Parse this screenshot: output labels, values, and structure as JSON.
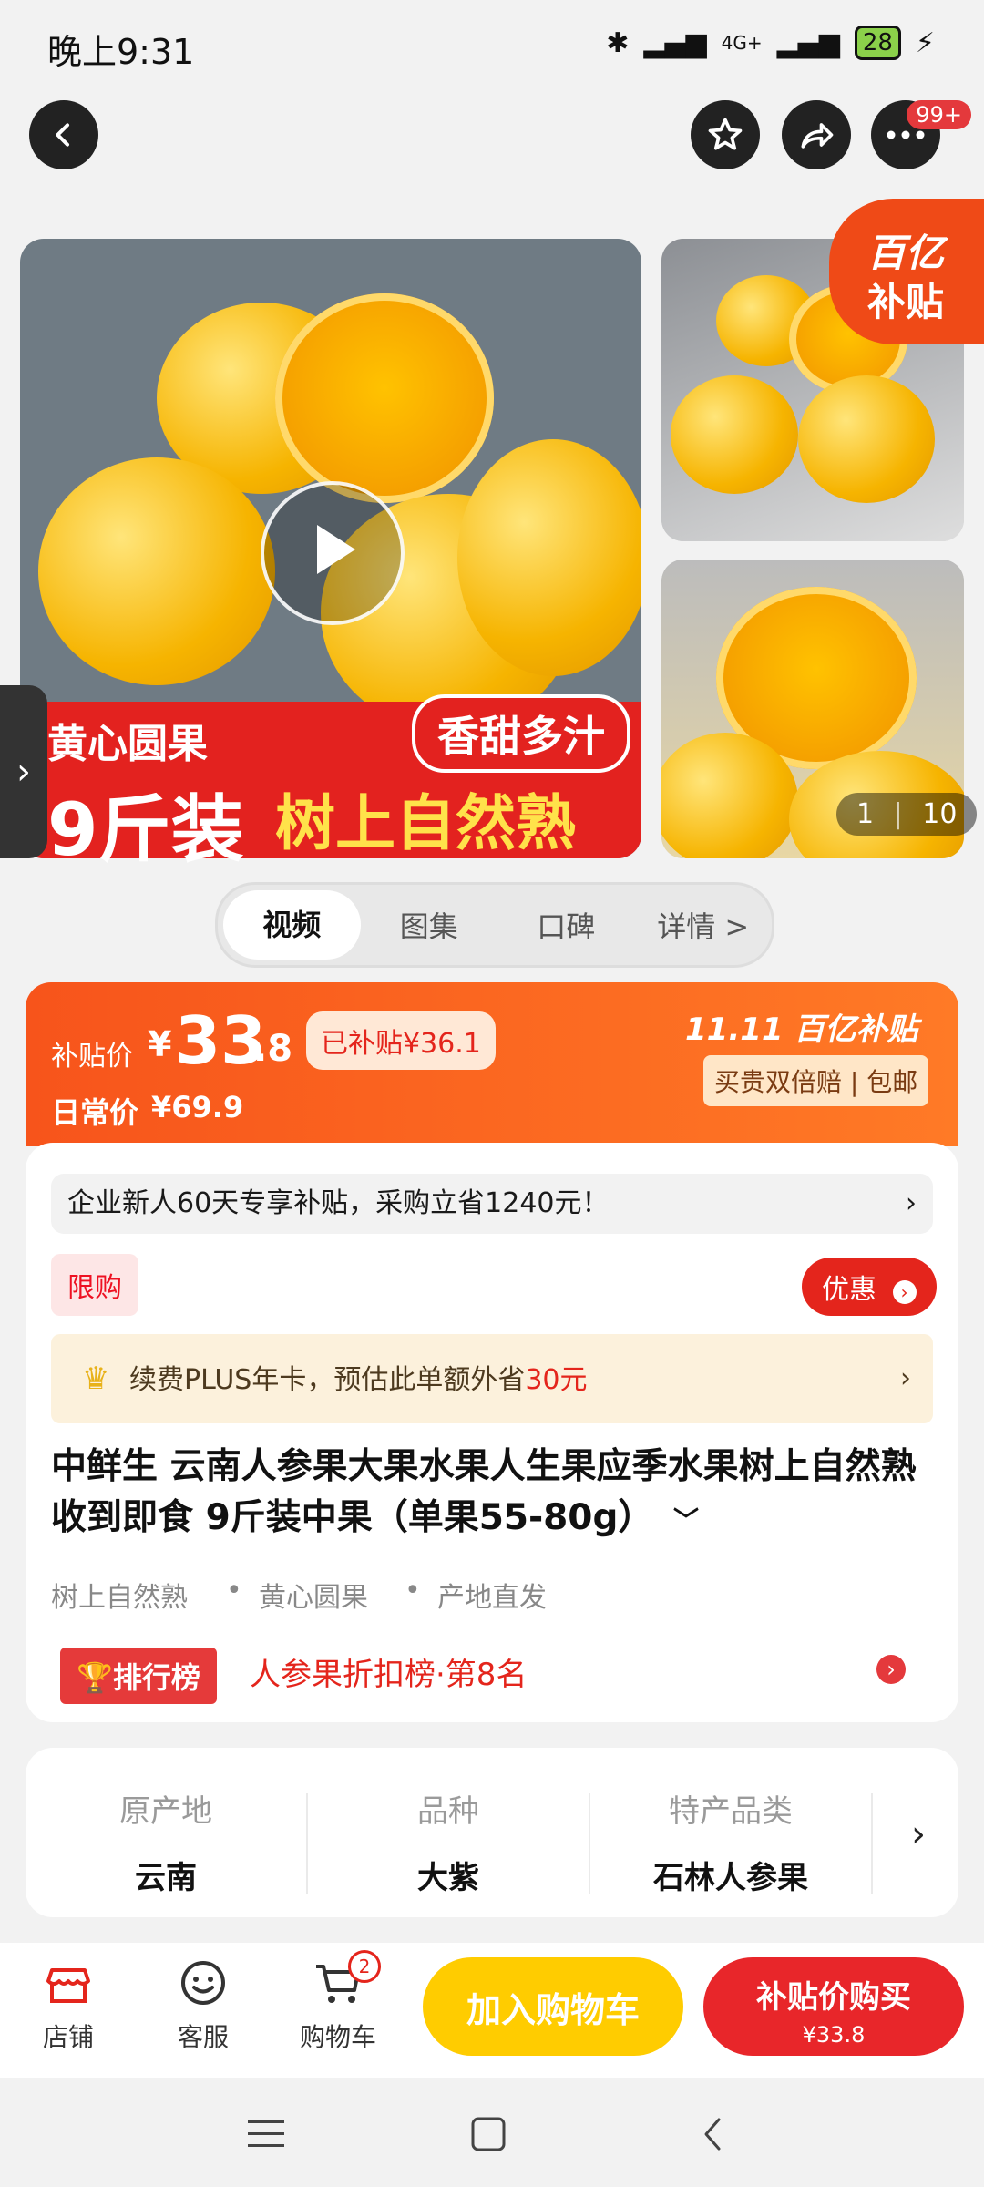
{
  "status_bar": {
    "time": "晚上9:31",
    "battery": "28",
    "network": "4G+"
  },
  "header": {
    "more_badge": "99+"
  },
  "gallery": {
    "main_banner_left": "黄心圆果",
    "main_banner_big": "9斤装",
    "main_banner_right": "树上自然熟",
    "main_tag": "香甜多汁",
    "badge_line1": "百亿",
    "badge_line2": "补贴",
    "counter_current": "1",
    "counter_total": "10"
  },
  "tabs": [
    {
      "label": "视频"
    },
    {
      "label": "图集"
    },
    {
      "label": "口碑"
    },
    {
      "label": "详情 >"
    }
  ],
  "price": {
    "sub_label": "补贴价",
    "currency": "¥",
    "int": "33",
    "dec": ".8",
    "subsidy_tag": "已补贴¥36.1",
    "daily_label": "日常价",
    "daily_price": "¥69.9",
    "event_logo": "11.11 百亿补贴",
    "guarantee": "买贵双倍赔 | 包邮"
  },
  "info": {
    "notice": "企业新人60天专享补贴，采购立省1240元！",
    "limit_tag": "限购",
    "youhui": "优惠",
    "plus_text": "续费PLUS年卡，预估此单额外省",
    "plus_amount": "30元",
    "title": "中鲜生 云南人参果大果水果人生果应季水果树上自然熟收到即食 9斤装中果（单果55-80g）",
    "features": [
      "树上自然熟",
      "黄心圆果",
      "产地直发"
    ],
    "rank_tag": "排行榜",
    "rank_text": "人参果折扣榜·第8名"
  },
  "specs": [
    {
      "key": "原产地",
      "value": "云南"
    },
    {
      "key": "品种",
      "value": "大紫"
    },
    {
      "key": "特产品类",
      "value": "石林人参果"
    }
  ],
  "bottom_bar": {
    "store": "店铺",
    "service": "客服",
    "cart": "购物车",
    "cart_count": "2",
    "add_cart": "加入购物车",
    "buy_label": "补贴价购买",
    "buy_price": "¥33.8"
  },
  "colors": {
    "accent_red": "#e4251c",
    "price_orange": "#f7541b",
    "cart_yellow": "#ffcc00"
  }
}
